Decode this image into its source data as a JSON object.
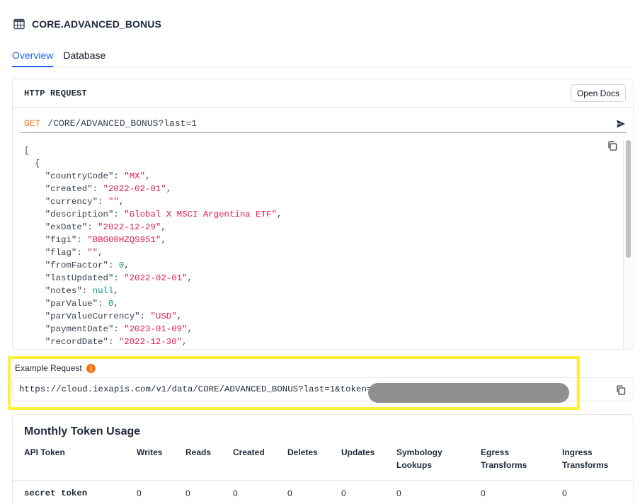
{
  "header": {
    "title": "CORE.ADVANCED_BONUS"
  },
  "tabs": [
    {
      "label": "Overview",
      "active": true
    },
    {
      "label": "Database",
      "active": false
    }
  ],
  "http_request": {
    "title": "HTTP REQUEST",
    "open_docs_label": "Open Docs",
    "method": "GET",
    "path": "/CORE/ADVANCED_BONUS?last=1"
  },
  "response_lines": [
    [
      {
        "t": "p",
        "v": "["
      }
    ],
    [
      {
        "t": "p",
        "v": "  {"
      }
    ],
    [
      {
        "t": "p",
        "v": "    \"countryCode\": "
      },
      {
        "t": "s",
        "v": "\"MX\""
      },
      {
        "t": "p",
        "v": ","
      }
    ],
    [
      {
        "t": "p",
        "v": "    \"created\": "
      },
      {
        "t": "s",
        "v": "\"2022-02-01\""
      },
      {
        "t": "p",
        "v": ","
      }
    ],
    [
      {
        "t": "p",
        "v": "    \"currency\": "
      },
      {
        "t": "s",
        "v": "\"\""
      },
      {
        "t": "p",
        "v": ","
      }
    ],
    [
      {
        "t": "p",
        "v": "    \"description\": "
      },
      {
        "t": "s",
        "v": "\"Global X MSCI Argentina ETF\""
      },
      {
        "t": "p",
        "v": ","
      }
    ],
    [
      {
        "t": "p",
        "v": "    \"exDate\": "
      },
      {
        "t": "s",
        "v": "\"2022-12-29\""
      },
      {
        "t": "p",
        "v": ","
      }
    ],
    [
      {
        "t": "p",
        "v": "    \"figi\": "
      },
      {
        "t": "s",
        "v": "\"BBG00HZQS951\""
      },
      {
        "t": "p",
        "v": ","
      }
    ],
    [
      {
        "t": "p",
        "v": "    \"flag\": "
      },
      {
        "t": "s",
        "v": "\"\""
      },
      {
        "t": "p",
        "v": ","
      }
    ],
    [
      {
        "t": "p",
        "v": "    \"fromFactor\": "
      },
      {
        "t": "n",
        "v": "0"
      },
      {
        "t": "p",
        "v": ","
      }
    ],
    [
      {
        "t": "p",
        "v": "    \"lastUpdated\": "
      },
      {
        "t": "s",
        "v": "\"2022-02-01\""
      },
      {
        "t": "p",
        "v": ","
      }
    ],
    [
      {
        "t": "p",
        "v": "    \"notes\": "
      },
      {
        "t": "n",
        "v": "null"
      },
      {
        "t": "p",
        "v": ","
      }
    ],
    [
      {
        "t": "p",
        "v": "    \"parValue\": "
      },
      {
        "t": "n",
        "v": "0"
      },
      {
        "t": "p",
        "v": ","
      }
    ],
    [
      {
        "t": "p",
        "v": "    \"parValueCurrency\": "
      },
      {
        "t": "s",
        "v": "\"USD\""
      },
      {
        "t": "p",
        "v": ","
      }
    ],
    [
      {
        "t": "p",
        "v": "    \"paymentDate\": "
      },
      {
        "t": "s",
        "v": "\"2023-01-09\""
      },
      {
        "t": "p",
        "v": ","
      }
    ],
    [
      {
        "t": "p",
        "v": "    \"recordDate\": "
      },
      {
        "t": "s",
        "v": "\"2022-12-30\""
      },
      {
        "t": "p",
        "v": ","
      }
    ]
  ],
  "example_request": {
    "label": "Example Request",
    "url": "https://cloud.iexapis.com/v1/data/CORE/ADVANCED_BONUS?last=1&token="
  },
  "usage": {
    "title": "Monthly Token Usage",
    "columns": [
      {
        "line1": "",
        "line2": "API Token"
      },
      {
        "line1": "",
        "line2": "Writes"
      },
      {
        "line1": "",
        "line2": "Reads"
      },
      {
        "line1": "",
        "line2": "Created"
      },
      {
        "line1": "",
        "line2": "Deletes"
      },
      {
        "line1": "",
        "line2": "Updates"
      },
      {
        "line1": "Symbology",
        "line2": "Lookups"
      },
      {
        "line1": "Egress",
        "line2": "Transforms"
      },
      {
        "line1": "Ingress",
        "line2": "Transforms"
      }
    ],
    "rows": [
      [
        "secret token",
        "0",
        "0",
        "0",
        "0",
        "0",
        "0",
        "0",
        "0"
      ]
    ]
  },
  "colors": {
    "accent": "#2563eb",
    "method": "#f97316",
    "string": "#e11d48",
    "number": "#0d9488",
    "highlight": "#fcf03b"
  }
}
